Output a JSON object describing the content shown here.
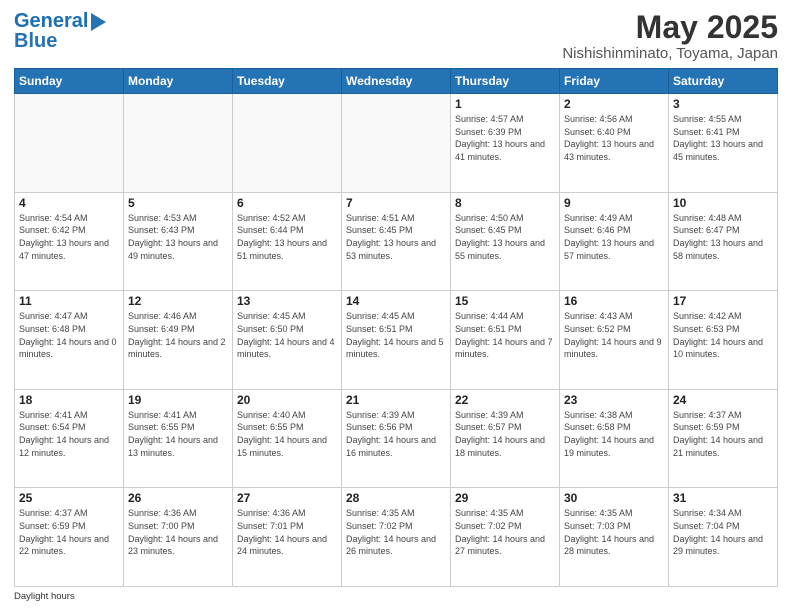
{
  "logo": {
    "line1": "General",
    "line2": "Blue"
  },
  "title": "May 2025",
  "subtitle": "Nishishinminato, Toyama, Japan",
  "footer_note": "Daylight hours",
  "days_of_week": [
    "Sunday",
    "Monday",
    "Tuesday",
    "Wednesday",
    "Thursday",
    "Friday",
    "Saturday"
  ],
  "weeks": [
    [
      {
        "day": "",
        "sunrise": "",
        "sunset": "",
        "daylight": "",
        "empty": true
      },
      {
        "day": "",
        "sunrise": "",
        "sunset": "",
        "daylight": "",
        "empty": true
      },
      {
        "day": "",
        "sunrise": "",
        "sunset": "",
        "daylight": "",
        "empty": true
      },
      {
        "day": "",
        "sunrise": "",
        "sunset": "",
        "daylight": "",
        "empty": true
      },
      {
        "day": "1",
        "sunrise": "Sunrise: 4:57 AM",
        "sunset": "Sunset: 6:39 PM",
        "daylight": "Daylight: 13 hours and 41 minutes.",
        "empty": false
      },
      {
        "day": "2",
        "sunrise": "Sunrise: 4:56 AM",
        "sunset": "Sunset: 6:40 PM",
        "daylight": "Daylight: 13 hours and 43 minutes.",
        "empty": false
      },
      {
        "day": "3",
        "sunrise": "Sunrise: 4:55 AM",
        "sunset": "Sunset: 6:41 PM",
        "daylight": "Daylight: 13 hours and 45 minutes.",
        "empty": false
      }
    ],
    [
      {
        "day": "4",
        "sunrise": "Sunrise: 4:54 AM",
        "sunset": "Sunset: 6:42 PM",
        "daylight": "Daylight: 13 hours and 47 minutes.",
        "empty": false
      },
      {
        "day": "5",
        "sunrise": "Sunrise: 4:53 AM",
        "sunset": "Sunset: 6:43 PM",
        "daylight": "Daylight: 13 hours and 49 minutes.",
        "empty": false
      },
      {
        "day": "6",
        "sunrise": "Sunrise: 4:52 AM",
        "sunset": "Sunset: 6:44 PM",
        "daylight": "Daylight: 13 hours and 51 minutes.",
        "empty": false
      },
      {
        "day": "7",
        "sunrise": "Sunrise: 4:51 AM",
        "sunset": "Sunset: 6:45 PM",
        "daylight": "Daylight: 13 hours and 53 minutes.",
        "empty": false
      },
      {
        "day": "8",
        "sunrise": "Sunrise: 4:50 AM",
        "sunset": "Sunset: 6:45 PM",
        "daylight": "Daylight: 13 hours and 55 minutes.",
        "empty": false
      },
      {
        "day": "9",
        "sunrise": "Sunrise: 4:49 AM",
        "sunset": "Sunset: 6:46 PM",
        "daylight": "Daylight: 13 hours and 57 minutes.",
        "empty": false
      },
      {
        "day": "10",
        "sunrise": "Sunrise: 4:48 AM",
        "sunset": "Sunset: 6:47 PM",
        "daylight": "Daylight: 13 hours and 58 minutes.",
        "empty": false
      }
    ],
    [
      {
        "day": "11",
        "sunrise": "Sunrise: 4:47 AM",
        "sunset": "Sunset: 6:48 PM",
        "daylight": "Daylight: 14 hours and 0 minutes.",
        "empty": false
      },
      {
        "day": "12",
        "sunrise": "Sunrise: 4:46 AM",
        "sunset": "Sunset: 6:49 PM",
        "daylight": "Daylight: 14 hours and 2 minutes.",
        "empty": false
      },
      {
        "day": "13",
        "sunrise": "Sunrise: 4:45 AM",
        "sunset": "Sunset: 6:50 PM",
        "daylight": "Daylight: 14 hours and 4 minutes.",
        "empty": false
      },
      {
        "day": "14",
        "sunrise": "Sunrise: 4:45 AM",
        "sunset": "Sunset: 6:51 PM",
        "daylight": "Daylight: 14 hours and 5 minutes.",
        "empty": false
      },
      {
        "day": "15",
        "sunrise": "Sunrise: 4:44 AM",
        "sunset": "Sunset: 6:51 PM",
        "daylight": "Daylight: 14 hours and 7 minutes.",
        "empty": false
      },
      {
        "day": "16",
        "sunrise": "Sunrise: 4:43 AM",
        "sunset": "Sunset: 6:52 PM",
        "daylight": "Daylight: 14 hours and 9 minutes.",
        "empty": false
      },
      {
        "day": "17",
        "sunrise": "Sunrise: 4:42 AM",
        "sunset": "Sunset: 6:53 PM",
        "daylight": "Daylight: 14 hours and 10 minutes.",
        "empty": false
      }
    ],
    [
      {
        "day": "18",
        "sunrise": "Sunrise: 4:41 AM",
        "sunset": "Sunset: 6:54 PM",
        "daylight": "Daylight: 14 hours and 12 minutes.",
        "empty": false
      },
      {
        "day": "19",
        "sunrise": "Sunrise: 4:41 AM",
        "sunset": "Sunset: 6:55 PM",
        "daylight": "Daylight: 14 hours and 13 minutes.",
        "empty": false
      },
      {
        "day": "20",
        "sunrise": "Sunrise: 4:40 AM",
        "sunset": "Sunset: 6:55 PM",
        "daylight": "Daylight: 14 hours and 15 minutes.",
        "empty": false
      },
      {
        "day": "21",
        "sunrise": "Sunrise: 4:39 AM",
        "sunset": "Sunset: 6:56 PM",
        "daylight": "Daylight: 14 hours and 16 minutes.",
        "empty": false
      },
      {
        "day": "22",
        "sunrise": "Sunrise: 4:39 AM",
        "sunset": "Sunset: 6:57 PM",
        "daylight": "Daylight: 14 hours and 18 minutes.",
        "empty": false
      },
      {
        "day": "23",
        "sunrise": "Sunrise: 4:38 AM",
        "sunset": "Sunset: 6:58 PM",
        "daylight": "Daylight: 14 hours and 19 minutes.",
        "empty": false
      },
      {
        "day": "24",
        "sunrise": "Sunrise: 4:37 AM",
        "sunset": "Sunset: 6:59 PM",
        "daylight": "Daylight: 14 hours and 21 minutes.",
        "empty": false
      }
    ],
    [
      {
        "day": "25",
        "sunrise": "Sunrise: 4:37 AM",
        "sunset": "Sunset: 6:59 PM",
        "daylight": "Daylight: 14 hours and 22 minutes.",
        "empty": false
      },
      {
        "day": "26",
        "sunrise": "Sunrise: 4:36 AM",
        "sunset": "Sunset: 7:00 PM",
        "daylight": "Daylight: 14 hours and 23 minutes.",
        "empty": false
      },
      {
        "day": "27",
        "sunrise": "Sunrise: 4:36 AM",
        "sunset": "Sunset: 7:01 PM",
        "daylight": "Daylight: 14 hours and 24 minutes.",
        "empty": false
      },
      {
        "day": "28",
        "sunrise": "Sunrise: 4:35 AM",
        "sunset": "Sunset: 7:02 PM",
        "daylight": "Daylight: 14 hours and 26 minutes.",
        "empty": false
      },
      {
        "day": "29",
        "sunrise": "Sunrise: 4:35 AM",
        "sunset": "Sunset: 7:02 PM",
        "daylight": "Daylight: 14 hours and 27 minutes.",
        "empty": false
      },
      {
        "day": "30",
        "sunrise": "Sunrise: 4:35 AM",
        "sunset": "Sunset: 7:03 PM",
        "daylight": "Daylight: 14 hours and 28 minutes.",
        "empty": false
      },
      {
        "day": "31",
        "sunrise": "Sunrise: 4:34 AM",
        "sunset": "Sunset: 7:04 PM",
        "daylight": "Daylight: 14 hours and 29 minutes.",
        "empty": false
      }
    ]
  ]
}
